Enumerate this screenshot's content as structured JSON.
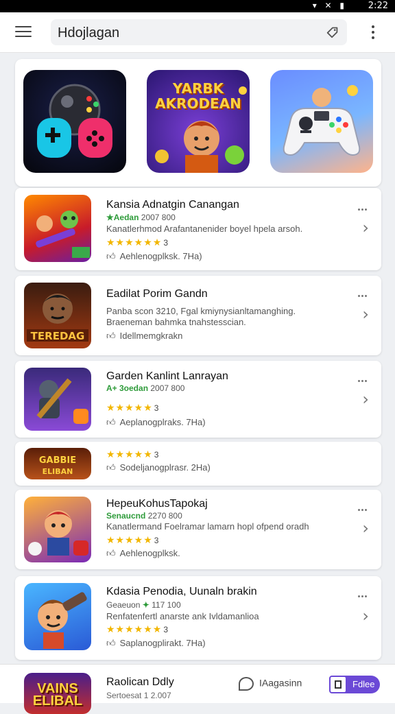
{
  "status": {
    "time": "2:22",
    "icons": "▾ ✕ ▮"
  },
  "search": {
    "query": "Hdojlagan"
  },
  "featured": [
    {
      "icon": "gamepad-character-icon"
    },
    {
      "icon": "game-logo-icon",
      "text": "YARBK AKRODEAN"
    },
    {
      "icon": "controller-icon"
    }
  ],
  "apps": [
    {
      "title": "Kansia Adnatgin Canangan",
      "meta_green": "★Aedan",
      "meta": "2007 800",
      "desc": "Kanatlerhmod Arafantanenider boyel hpela arsoh.",
      "stars": "★★★★★★",
      "rating": "3",
      "action": "Aehlenogplksk. 7Ha)"
    },
    {
      "title": "Eadilat Porim Gandn",
      "meta_green": "",
      "meta": "Panba scon 3210, Fgal kmiynysianltamanghing.",
      "desc": "Braeneman bahmka tnahstesscian.",
      "stars": "",
      "rating": "",
      "action": "Idellmemgkrakn"
    },
    {
      "title": "Garden Kanlint Lanrayan",
      "meta_green": "A+ 3oedan",
      "meta": "2007 800",
      "desc": "",
      "stars": "★★★★★",
      "rating": "3",
      "action": "Aeplanogplraks. 7Ha)"
    },
    {
      "title": "",
      "meta_green": "",
      "meta": "",
      "desc": "",
      "stars": "★★★★★",
      "rating": "3",
      "action": "Sodeljanogplrasr. 2Ha)"
    },
    {
      "title": "HepeuKohusTapokaj",
      "meta_green": "Senaucnd",
      "meta": "2270 800",
      "desc": "Kanatlermand Foelramar lamarn hopl ofpend oradh",
      "stars": "★★★★★",
      "rating": "3",
      "action": "Aehlenogplksk."
    },
    {
      "title": "Kdasia Penodia, Uunaln brakin",
      "meta_green": "Geaeuon",
      "meta": "117 100",
      "desc": "Renfatenfertl anarste ank Ivldamanlioa",
      "stars": "★★★★★★",
      "rating": "3",
      "action": "Saplanogplirakt. 7Ha)"
    }
  ],
  "bottom": {
    "thumb_text": "VAINS ELIBAL",
    "title": "Raolican Ddly",
    "subtitle": "Sertoesat 1 2.007",
    "chat_label": "IAagasinn",
    "button_label": "Fdlee"
  }
}
